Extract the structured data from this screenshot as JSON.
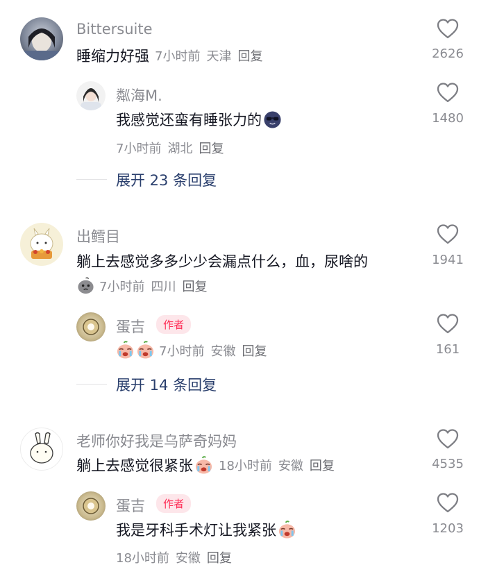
{
  "comments": [
    {
      "user": "Bittersuite",
      "text": "睡缩力好强",
      "time": "7小时前",
      "location": "天津",
      "reply_label": "回复",
      "likes": "2626",
      "replies": [
        {
          "user": "粼海M.",
          "text": "我感觉还蛮有睡张力的",
          "emoji": "sunglasses-face",
          "time": "7小时前",
          "location": "湖北",
          "reply_label": "回复",
          "likes": "1480"
        }
      ],
      "expand_label": "展开 23 条回复"
    },
    {
      "user": "出鳕目",
      "text": "躺上去感觉多多少少会漏点什么，血，尿啥的",
      "meta_emoji": "gray-blob-face",
      "time": "7小时前",
      "location": "四川",
      "reply_label": "回复",
      "likes": "1941",
      "replies": [
        {
          "user": "蛋吉",
          "badge": "作者",
          "emoji_only": [
            "crying-face",
            "crying-face"
          ],
          "time": "7小时前",
          "location": "安徽",
          "reply_label": "回复",
          "likes": "161"
        }
      ],
      "expand_label": "展开 14 条回复"
    },
    {
      "user": "老师你好我是乌萨奇妈妈",
      "text": "躺上去感觉很紧张",
      "emoji": "crying-face",
      "time": "18小时前",
      "location": "安徽",
      "reply_label": "回复",
      "likes": "4535",
      "replies": [
        {
          "user": "蛋吉",
          "badge": "作者",
          "text": "我是牙科手术灯让我紧张",
          "emoji": "crying-face",
          "time": "18小时前",
          "location": "安徽",
          "reply_label": "回复",
          "likes": "1203"
        }
      ]
    }
  ],
  "colors": {
    "username": "#8a8b91",
    "text": "#161823",
    "expand": "#2a3f6d",
    "author_badge_bg": "#fde6ea",
    "author_badge_text": "#fe2c55"
  }
}
